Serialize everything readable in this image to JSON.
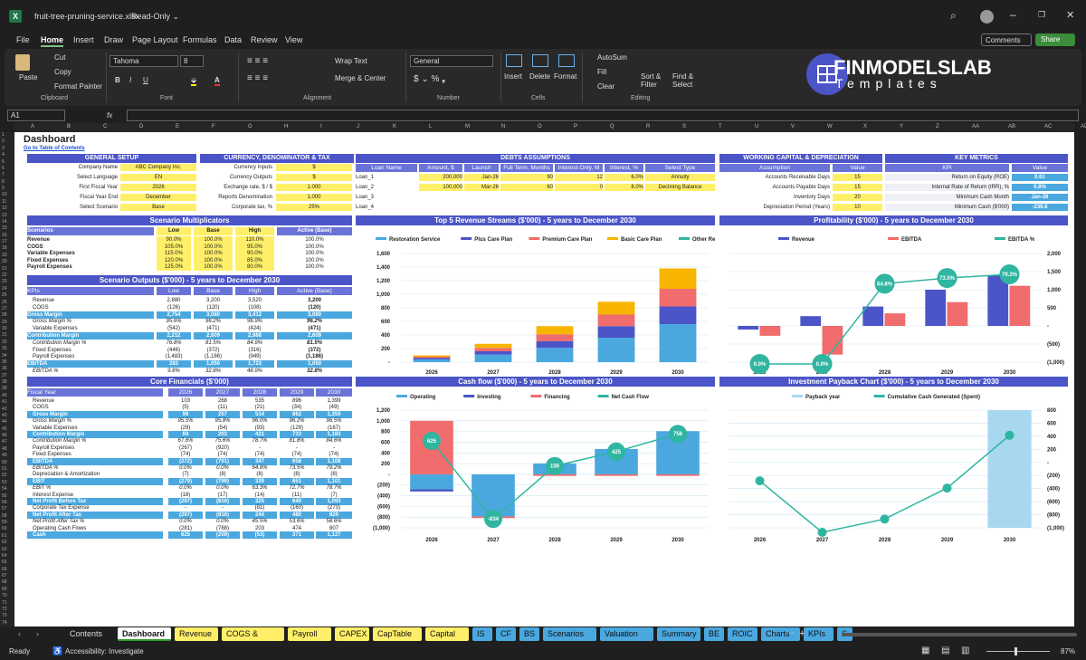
{
  "window": {
    "title": "fruit-tree-pruning-service.xlsx",
    "mode": "Read-Only ⌄"
  },
  "menu": [
    "File",
    "Home",
    "Insert",
    "Draw",
    "Page Layout",
    "Formulas",
    "Data",
    "Review",
    "View"
  ],
  "ribbon_buttons": {
    "comments": "Comments",
    "share": "Share"
  },
  "ribbon": {
    "paste": "Paste",
    "cut": "Cut",
    "copy": "Copy",
    "format_painter": "Format Painter",
    "clipboard": "Clipboard",
    "font_name": "Tahoma",
    "font_size": "8",
    "font": "Font",
    "wrap": "Wrap Text",
    "merge": "Merge & Center",
    "alignment": "Alignment",
    "number_format": "General",
    "number": "Number",
    "insert": "Insert",
    "delete": "Delete",
    "format": "Format",
    "cells": "Cells",
    "autosum": "AutoSum",
    "fill": "Fill",
    "clear": "Clear",
    "sort": "Sort & Filter",
    "find": "Find & Select",
    "editing": "Editing"
  },
  "brand": {
    "name": "FINMODELSLAB",
    "sub": "Templates"
  },
  "formula_bar": {
    "cell_ref": "A1",
    "fx": "fx"
  },
  "columns": [
    "A",
    "B",
    "C",
    "D",
    "E",
    "F",
    "G",
    "H",
    "I",
    "J",
    "K",
    "L",
    "M",
    "N",
    "O",
    "P",
    "Q",
    "R",
    "S",
    "T",
    "U",
    "V",
    "W",
    "X",
    "Y",
    "Z",
    "AA",
    "AB",
    "AC",
    "AD"
  ],
  "sheet": {
    "title": "Dashboard",
    "link": "Go to Table of Contents",
    "general_setup": {
      "header": "GENERAL SETUP",
      "rows": [
        [
          "Company Name",
          "ABC Company Inc."
        ],
        [
          "Select Language",
          "EN"
        ],
        [
          "First Fiscal Year",
          "2026"
        ],
        [
          "Fiscal Year End",
          "December"
        ],
        [
          "Select Scenario",
          "Base"
        ]
      ]
    },
    "currency": {
      "header": "CURRENCY, DENOMINATOR & TAX",
      "rows": [
        [
          "Currency Inputs",
          "$"
        ],
        [
          "Currency Outputs",
          "$"
        ],
        [
          "Exchange rate, $ / $",
          "1.000"
        ],
        [
          "Reports Denomination",
          "1,000"
        ],
        [
          "Corporate tax, %",
          "25%"
        ]
      ]
    },
    "debts": {
      "header": "DEBTS ASSUMPTIONS",
      "cols": [
        "Loan Name",
        "Amount, $",
        "Launch",
        "Full Term, Months",
        "Interest-Only, M",
        "Interest, %",
        "Select Type"
      ],
      "rows": [
        [
          "Loan_1",
          "200,000",
          "Jan-26",
          "90",
          "12",
          "6.0%",
          "Annuity"
        ],
        [
          "Loan_2",
          "100,000",
          "Mar-26",
          "60",
          "0",
          "8.0%",
          "Declining Balance"
        ],
        [
          "Loan_3",
          "",
          "",
          "",
          "",
          "",
          ""
        ],
        [
          "Loan_4",
          "",
          "",
          "",
          "",
          "",
          ""
        ]
      ]
    },
    "working_capital": {
      "header": "WORKING CAPITAL & DEPRECIATION",
      "cols": [
        "Assumption",
        "Value"
      ],
      "rows": [
        [
          "Accounts Receivable Days",
          "15"
        ],
        [
          "Accounts Payable Days",
          "15"
        ],
        [
          "Inventory Days",
          "20"
        ],
        [
          "Depreciation Period (Years)",
          "10"
        ]
      ]
    },
    "key_metrics": {
      "header": "KEY METRICS",
      "cols": [
        "KPI",
        "Value"
      ],
      "rows": [
        [
          "Return on Equity (ROE)",
          "0.61"
        ],
        [
          "Internal Rate of Return (IRR), %",
          "0.8%"
        ],
        [
          "Minimum Cash Month",
          "Jan-26"
        ],
        [
          "Minimum Cash ($'000)",
          "-239.6"
        ]
      ]
    },
    "scenario_mult": {
      "header": "Scenario Multiplicators",
      "cols": [
        "Scenarios",
        "Low",
        "Base",
        "High",
        "Active (Base)"
      ],
      "rows": [
        [
          "Revenue",
          "90.0%",
          "100.0%",
          "110.0%",
          "100.0%"
        ],
        [
          "COGS",
          "105.0%",
          "100.0%",
          "95.0%",
          "100.0%"
        ],
        [
          "Variable Expenses",
          "115.0%",
          "100.0%",
          "90.0%",
          "100.0%"
        ],
        [
          "Fixed Expenses",
          "120.0%",
          "100.0%",
          "85.0%",
          "100.0%"
        ],
        [
          "Payroll Expenses",
          "125.0%",
          "100.0%",
          "80.0%",
          "100.0%"
        ]
      ]
    },
    "scenario_out": {
      "header": "Scenario Outputs ($'000) - 5 years to December 2030",
      "cols": [
        "KPIs",
        "Low",
        "Base",
        "High",
        "Active (Base)"
      ],
      "rows": [
        [
          "Revenue",
          "2,880",
          "3,200",
          "3,520",
          "3,200",
          ""
        ],
        [
          "COGS",
          "(126)",
          "(120)",
          "(108)",
          "(120)",
          ""
        ],
        [
          "Gross Margin",
          "2,754",
          "3,080",
          "3,412",
          "3,080",
          "b"
        ],
        [
          "Gross Margin %",
          "95.6%",
          "96.2%",
          "96.9%",
          "96.2%",
          "i"
        ],
        [
          "Variable Expenses",
          "(542)",
          "(471)",
          "(424)",
          "(471)",
          ""
        ],
        [
          "Contribution Margin",
          "2,212",
          "2,609",
          "2,988",
          "2,609",
          "b"
        ],
        [
          "Contribution Margin %",
          "76.8%",
          "81.5%",
          "84.9%",
          "81.5%",
          "i"
        ],
        [
          "Fixed Expenses",
          "(446)",
          "(372)",
          "(316)",
          "(372)",
          ""
        ],
        [
          "Payroll Expenses",
          "(1,483)",
          "(1,186)",
          "(949)",
          "(1,186)",
          ""
        ],
        [
          "EBITDA",
          "283",
          "1,050",
          "1,723",
          "1,050",
          "b"
        ],
        [
          "EBITDA %",
          "9.8%",
          "32.8%",
          "48.9%",
          "32.8%",
          "i"
        ]
      ]
    },
    "core": {
      "header": "Core Financials ($'000)",
      "cols": [
        "Fiscal Year",
        "2026",
        "2027",
        "2028",
        "2029",
        "2030"
      ],
      "rows": [
        [
          "Revenue",
          "103",
          "268",
          "535",
          "896",
          "1,399",
          ""
        ],
        [
          "COGS",
          "(5)",
          "(11)",
          "(21)",
          "(34)",
          "(49)",
          ""
        ],
        [
          "Gross Margin",
          "98",
          "257",
          "514",
          "862",
          "1,350",
          "b"
        ],
        [
          "Gross Margin %",
          "95.5%",
          "95.8%",
          "96.0%",
          "96.2%",
          "96.5%",
          "i"
        ],
        [
          "Variable Expenses",
          "(29)",
          "(54)",
          "(93)",
          "(129)",
          "(167)",
          ""
        ],
        [
          "Contribution Margin",
          "69",
          "203",
          "421",
          "733",
          "1,183",
          "b"
        ],
        [
          "Contribution Margin %",
          "67.6%",
          "75.6%",
          "78.7%",
          "81.8%",
          "84.6%",
          "i"
        ],
        [
          "Payroll Expenses",
          "(267)",
          "(920)",
          "-",
          "-",
          "-",
          ""
        ],
        [
          "Fixed Expenses",
          "(74)",
          "(74)",
          "(74)",
          "(74)",
          "(74)",
          ""
        ],
        [
          "EBITDA",
          "(272)",
          "(791)",
          "347",
          "658",
          "1,108",
          "b"
        ],
        [
          "EBITDA %",
          "0.0%",
          "0.0%",
          "64.8%",
          "73.5%",
          "79.2%",
          "i"
        ],
        [
          "Depreciation & Amortization",
          "(7)",
          "(8)",
          "(8)",
          "(8)",
          "(8)",
          ""
        ],
        [
          "EBIT",
          "(279)",
          "(799)",
          "339",
          "651",
          "1,101",
          "b"
        ],
        [
          "EBIT %",
          "0.0%",
          "0.0%",
          "63.3%",
          "72.7%",
          "78.7%",
          "i"
        ],
        [
          "Interest Expense",
          "(18)",
          "(17)",
          "(14)",
          "(11)",
          "(7)",
          ""
        ],
        [
          "Net Profit Before Tax",
          "(297)",
          "(816)",
          "325",
          "640",
          "1,093",
          "b"
        ],
        [
          "Corporate Tax Expense",
          "-",
          "-",
          "(81)",
          "(160)",
          "(273)",
          ""
        ],
        [
          "Net Profit After Tax",
          "(297)",
          "(816)",
          "244",
          "480",
          "820",
          "b"
        ],
        [
          "Net Profit After Tax %",
          "0.0%",
          "0.0%",
          "45.5%",
          "53.6%",
          "58.6%",
          "i"
        ],
        [
          "Operating Cash Flows",
          "(281)",
          "(788)",
          "203",
          "474",
          "807",
          ""
        ],
        [
          "Cash",
          "625",
          "(209)",
          "(53)",
          "371",
          "1,127",
          "b"
        ]
      ]
    }
  },
  "chart_data": [
    {
      "type": "bar",
      "title": "Top 5 Revenue Streams ($'000) - 5 years to December 2030",
      "categories": [
        "2026",
        "2027",
        "2028",
        "2029",
        "2030"
      ],
      "ylim": [
        0,
        1600
      ],
      "series": [
        {
          "name": "Restoration Service",
          "color": "#4aa8df",
          "values": [
            40,
            110,
            210,
            360,
            560
          ]
        },
        {
          "name": "Plus Care Plan",
          "color": "#4b55c7",
          "values": [
            20,
            50,
            100,
            170,
            260
          ]
        },
        {
          "name": "Premium Care Plan",
          "color": "#f16c6c",
          "values": [
            20,
            50,
            100,
            170,
            260
          ]
        },
        {
          "name": "Basic Care Plan",
          "color": "#f7b500",
          "values": [
            20,
            60,
            120,
            190,
            300
          ]
        },
        {
          "name": "Other Revenue",
          "color": "#2fb5a0",
          "values": [
            0,
            0,
            0,
            0,
            0
          ]
        }
      ]
    },
    {
      "type": "bar+line",
      "title": "Profitability ($'000) - 5 years to December 2030",
      "categories": [
        "2026",
        "2027",
        "2028",
        "2029",
        "2030"
      ],
      "ylim": [
        -1000,
        2000
      ],
      "series": [
        {
          "name": "Revenue",
          "color": "#4b55c7",
          "values": [
            -100,
            270,
            535,
            1000,
            1400
          ]
        },
        {
          "name": "EBITDA",
          "color": "#f16c6c",
          "values": [
            -272,
            -791,
            347,
            658,
            1108
          ]
        },
        {
          "name": "EBITDA %",
          "color": "#2fb5a0",
          "values": [
            0,
            0,
            64.8,
            73.5,
            79.2
          ],
          "labels": [
            "0.0%",
            "0.0%",
            "64.8%",
            "73.5%",
            "79.2%"
          ]
        }
      ]
    },
    {
      "type": "bar+line",
      "title": "Cash flow ($'000) - 5 years to December 2030",
      "categories": [
        "2026",
        "2027",
        "2028",
        "2029",
        "2030"
      ],
      "ylim": [
        -1000,
        1200
      ],
      "series": [
        {
          "name": "Operating",
          "color": "#4aa8df",
          "values": [
            -281,
            -788,
            203,
            474,
            807
          ]
        },
        {
          "name": "Investing",
          "color": "#4b55c7",
          "values": [
            -40,
            0,
            0,
            0,
            0
          ]
        },
        {
          "name": "Financing",
          "color": "#f16c6c",
          "values": [
            1000,
            -30,
            -30,
            -30,
            -30
          ]
        },
        {
          "name": "Net Cash Flow",
          "color": "#2fb5a0",
          "values": [
            625,
            -834,
            156,
            425,
            756
          ],
          "labels": [
            "625",
            "-834",
            "156",
            "425",
            "756"
          ]
        }
      ]
    },
    {
      "type": "bar+line",
      "title": "Investment Payback Chart ($'000) - 5 years to December 2030",
      "categories": [
        "2026",
        "2027",
        "2028",
        "2029",
        "2030"
      ],
      "ylim": [
        -1000,
        800
      ],
      "series": [
        {
          "name": "Payback year",
          "color": "#a8d8f0",
          "values": [
            0,
            0,
            0,
            0,
            800
          ]
        },
        {
          "name": "Cumulative Cash Generated (Spent)",
          "color": "#2fb5a0",
          "values": [
            -281,
            -1069,
            -866,
            -392,
            415
          ]
        }
      ]
    }
  ],
  "sheet_tabs": [
    {
      "label": "Contents",
      "color": "#1f1f1f",
      "text": "#ddd"
    },
    {
      "label": "Dashboard",
      "color": "#ffffff",
      "text": "#111"
    },
    {
      "label": "Revenue",
      "color": "#ffef68",
      "text": "#111"
    },
    {
      "label": "COGS & OPEX",
      "color": "#ffef68",
      "text": "#111"
    },
    {
      "label": "Payroll",
      "color": "#ffef68",
      "text": "#111"
    },
    {
      "label": "CAPEX",
      "color": "#ffef68",
      "text": "#111"
    },
    {
      "label": "CapTable",
      "color": "#ffef68",
      "text": "#111"
    },
    {
      "label": "Capital",
      "color": "#ffef68",
      "text": "#111"
    },
    {
      "label": "IS",
      "color": "#4aa8df",
      "text": "#111"
    },
    {
      "label": "CF",
      "color": "#4aa8df",
      "text": "#111"
    },
    {
      "label": "BS",
      "color": "#4aa8df",
      "text": "#111"
    },
    {
      "label": "Scenarios",
      "color": "#4aa8df",
      "text": "#111"
    },
    {
      "label": "Valuation",
      "color": "#4aa8df",
      "text": "#111"
    },
    {
      "label": "Summary",
      "color": "#4aa8df",
      "text": "#111"
    },
    {
      "label": "BE",
      "color": "#4aa8df",
      "text": "#111"
    },
    {
      "label": "ROIC",
      "color": "#4aa8df",
      "text": "#111"
    },
    {
      "label": "Charts",
      "color": "#4aa8df",
      "text": "#111"
    },
    {
      "label": "KPIs",
      "color": "#4aa8df",
      "text": "#111"
    },
    {
      "label": "S",
      "color": "#4aa8df",
      "text": "#111"
    }
  ],
  "status": {
    "ready": "Ready",
    "accessibility": "Accessibility: Investigate",
    "zoom": "87%"
  }
}
